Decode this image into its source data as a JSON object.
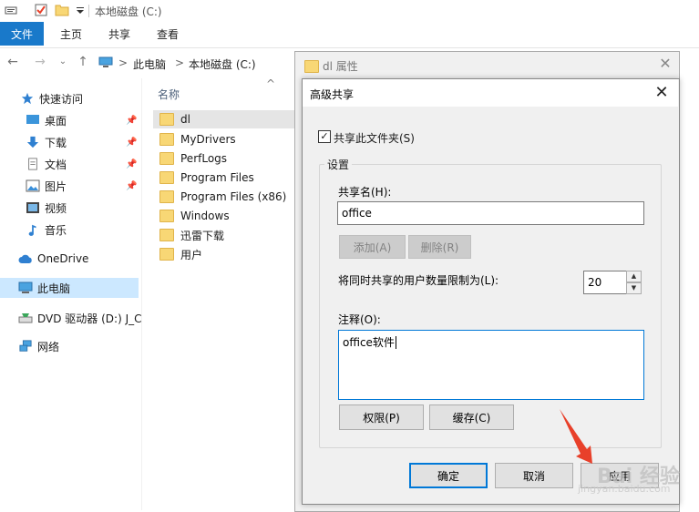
{
  "window": {
    "title": "本地磁盘 (C:)",
    "quick_access_icons": [
      "properties-icon",
      "checkbox-icon",
      "folder-icon",
      "dropdown-icon"
    ]
  },
  "ribbon": {
    "tabs": [
      {
        "label": "文件",
        "active": true
      },
      {
        "label": "主页"
      },
      {
        "label": "共享"
      },
      {
        "label": "查看"
      }
    ]
  },
  "address": {
    "crumbs": [
      "此电脑",
      "本地磁盘 (C:)"
    ],
    "separators": [
      ">",
      ">"
    ]
  },
  "nav": {
    "items": [
      {
        "label": "快速访问",
        "icon": "star-icon"
      },
      {
        "label": "桌面",
        "icon": "desktop-icon",
        "pinned": true
      },
      {
        "label": "下载",
        "icon": "download-icon",
        "pinned": true
      },
      {
        "label": "文档",
        "icon": "document-icon",
        "pinned": true
      },
      {
        "label": "图片",
        "icon": "picture-icon",
        "pinned": true
      },
      {
        "label": "视频",
        "icon": "video-icon"
      },
      {
        "label": "音乐",
        "icon": "music-icon"
      },
      {
        "label": "OneDrive",
        "icon": "cloud-icon"
      },
      {
        "label": "此电脑",
        "icon": "computer-icon",
        "selected": true
      },
      {
        "label": "DVD 驱动器 (D:) J_C",
        "icon": "dvd-icon"
      },
      {
        "label": "网络",
        "icon": "network-icon"
      }
    ]
  },
  "filelist": {
    "column": "名称",
    "files": [
      {
        "name": "dl",
        "selected": true
      },
      {
        "name": "MyDrivers"
      },
      {
        "name": "PerfLogs"
      },
      {
        "name": "Program Files"
      },
      {
        "name": "Program Files (x86)"
      },
      {
        "name": "Windows"
      },
      {
        "name": "迅雷下载"
      },
      {
        "name": "用户"
      }
    ]
  },
  "properties": {
    "title": "dl 属性"
  },
  "dialog": {
    "title": "高级共享",
    "share_checkbox": {
      "label": "共享此文件夹(S)",
      "checked": true
    },
    "group_title": "设置",
    "share_name_label": "共享名(H):",
    "share_name_value": "office",
    "add_button": "添加(A)",
    "remove_button": "删除(R)",
    "limit_label": "将同时共享的用户数量限制为(L):",
    "limit_value": "20",
    "comment_label": "注释(O):",
    "comment_value": "office软件",
    "permissions_button": "权限(P)",
    "caching_button": "缓存(C)",
    "ok_button": "确定",
    "cancel_button": "取消",
    "apply_button": "应用"
  },
  "watermark": {
    "text": "Bai 经验",
    "url": "jingyan.baidu.com"
  },
  "colors": {
    "accent": "#1979ca",
    "selection": "#cce8ff",
    "arrow": "#e8402a"
  }
}
